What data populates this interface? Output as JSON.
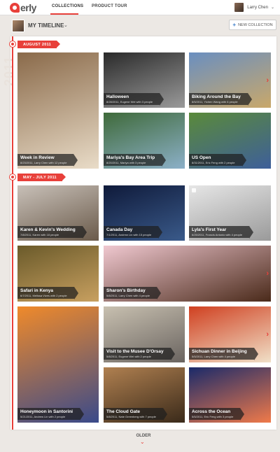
{
  "app": {
    "logo_text": "erly"
  },
  "nav": {
    "tabs": [
      {
        "label": "COLLECTIONS",
        "active": true
      },
      {
        "label": "PRODUCT TOUR",
        "active": false
      }
    ],
    "user_name": "Larry Chen",
    "user_caret": "⌄"
  },
  "subheader": {
    "title": "MY TIMELINE",
    "title_caret": "⌄",
    "new_collection_label": "NEW COLLECTION",
    "new_collection_icon": "+"
  },
  "timeline": {
    "year_watermark": "2011",
    "sections": [
      {
        "label": "AUGUST 2011"
      },
      {
        "label": "MAY - JULY 2011"
      }
    ]
  },
  "tiles": [
    {
      "title": "Halloween",
      "meta": "8/28/2011, Eugene Wei with 3 people",
      "colors": [
        "#2a2a2a",
        "#9a9a9a"
      ],
      "locked": false,
      "arrow": false
    },
    {
      "title": "Biking Around the Bay",
      "meta": "8/5/2011, Yichen Wang with 6 people",
      "colors": [
        "#6a8fc0",
        "#c9a86a"
      ],
      "locked": false,
      "arrow": true
    },
    {
      "title": "Week in Review",
      "meta": "8/23/2011, Larry Chen with 12 people",
      "colors": [
        "#8a6a4a",
        "#e9dcc8"
      ],
      "locked": false,
      "arrow": false
    },
    {
      "title": "Mariya's Bay Area Trip",
      "meta": "8/20/2011, Mariya with 3 people",
      "colors": [
        "#3f6a3a",
        "#8cb0c8"
      ],
      "locked": false,
      "arrow": false
    },
    {
      "title": "US Open",
      "meta": "8/31/2011, Eric Feng with 2 people",
      "colors": [
        "#5a8a3a",
        "#3e5f9a"
      ],
      "locked": false,
      "arrow": false
    },
    {
      "title": "Karen & Kevin's Wedding",
      "meta": "7/8/2011, Karen with 18 people",
      "colors": [
        "#c8c0b8",
        "#6a5a4a"
      ],
      "locked": false,
      "arrow": false
    },
    {
      "title": "Canada Day",
      "meta": "7/1/2011, Andrew Lin with 15 people",
      "colors": [
        "#0f1a3a",
        "#3a5a8a"
      ],
      "locked": false,
      "arrow": false
    },
    {
      "title": "Lyla's First Year",
      "meta": "6/25/2011, Francis Antonio with 4 people",
      "colors": [
        "#e6e6e6",
        "#9a9a9a"
      ],
      "locked": true,
      "arrow": false
    },
    {
      "title": "Safari in Kenya",
      "meta": "6/7/2011, Melissa Vives with 2 people",
      "colors": [
        "#6a5a2a",
        "#c8a060"
      ],
      "locked": false,
      "arrow": false
    },
    {
      "title": "Sharon's Birthday",
      "meta": "5/8/2011, Larry Chen with 4 people",
      "colors": [
        "#f0c8d0",
        "#4a2a1a"
      ],
      "locked": false,
      "arrow": true
    },
    {
      "title": "Honeymoon in Santorini",
      "meta": "5/21/2011, Andrew Lin with 2 people",
      "colors": [
        "#f08a2a",
        "#3a4a8a"
      ],
      "locked": false,
      "arrow": false
    },
    {
      "title": "Visit to the Musee D'Orsay",
      "meta": "5/8/2011, Eugene Wei with 2 people",
      "colors": [
        "#c8c0b0",
        "#6a6460"
      ],
      "locked": false,
      "arrow": false
    },
    {
      "title": "Sichuan Dinner in Beijing",
      "meta": "5/5/2011, Larry Chen with 4 people",
      "colors": [
        "#d04020",
        "#f0e0c8"
      ],
      "locked": false,
      "arrow": true
    },
    {
      "title": "The Cloud Gate",
      "meta": "5/8/2011, Nate Greenberg with 7 people",
      "colors": [
        "#b08050",
        "#3a2a1a"
      ],
      "locked": false,
      "arrow": false
    },
    {
      "title": "Across the Ocean",
      "meta": "5/5/2011, Eric Feng with 3 people",
      "colors": [
        "#1a2a6a",
        "#f07a4a"
      ],
      "locked": false,
      "arrow": false
    }
  ],
  "footer": {
    "older_label": "OLDER",
    "older_chevron": "⌄"
  }
}
